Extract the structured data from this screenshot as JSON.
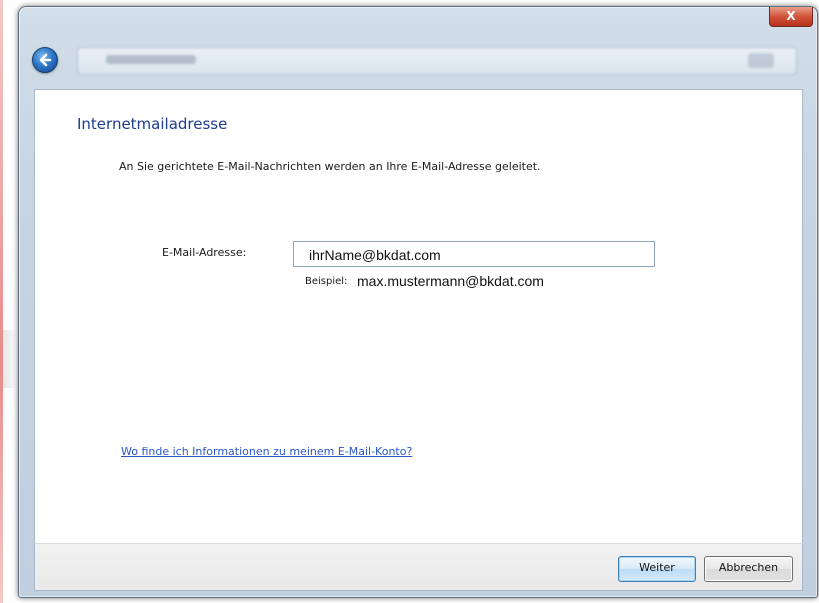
{
  "window": {
    "close_label": "X",
    "title_blurred": ""
  },
  "page": {
    "title": "Internetmailadresse",
    "intro": "An Sie gerichtete E-Mail-Nachrichten werden an Ihre E-Mail-Adresse geleitet."
  },
  "form": {
    "email_label": "E-Mail-Adresse:",
    "email_value": "ihrName@bkdat.com",
    "example_label": "Beispiel:",
    "example_value": "max.mustermann@bkdat.com"
  },
  "help_link": "Wo finde ich Informationen zu meinem E-Mail-Konto?",
  "buttons": {
    "next": "Weiter",
    "cancel": "Abbrechen"
  },
  "icons": {
    "back": "back-arrow-icon",
    "close": "close-icon"
  },
  "colors": {
    "title": "#1d3b8f",
    "link": "#2a56c6",
    "close_button": "#c8442c",
    "back_button": "#2e79c9"
  }
}
